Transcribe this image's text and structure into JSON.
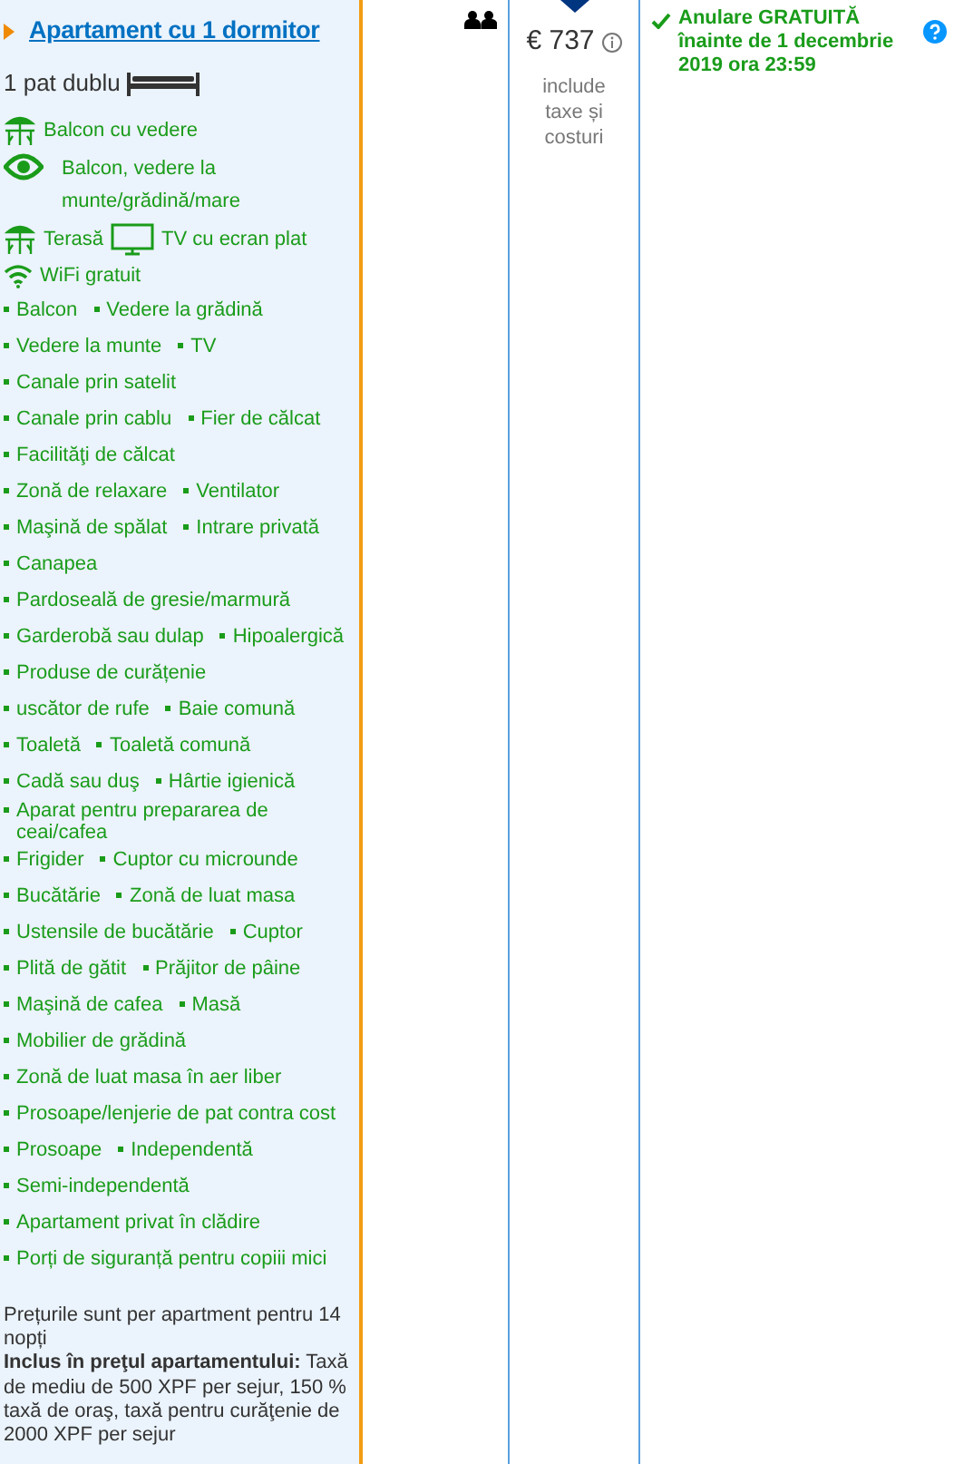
{
  "room": {
    "title": "Apartament cu 1 dormitor",
    "bed": "1 pat dublu",
    "highlights": [
      [
        "Balcon cu vedere"
      ],
      [
        "Balcon, vedere la munte/grădină/mare"
      ],
      [
        "Terasă",
        "TV cu ecran plat"
      ],
      [
        "WiFi gratuit"
      ]
    ],
    "facilities": [
      [
        "Balcon",
        "Vedere la grădină"
      ],
      [
        "Vedere la munte",
        "TV"
      ],
      [
        "Canale prin satelit"
      ],
      [
        "Canale prin cablu",
        "Fier de călcat"
      ],
      [
        "Facilităţi de călcat"
      ],
      [
        "Zonă de relaxare",
        "Ventilator"
      ],
      [
        "Maşină de spălat",
        "Intrare privată"
      ],
      [
        "Canapea"
      ],
      [
        "Pardoseală de gresie/marmură"
      ],
      [
        "Garderobă sau dulap",
        "Hipoalergică"
      ],
      [
        "Produse de curățenie"
      ],
      [
        "uscător de rufe",
        "Baie comună"
      ],
      [
        "Toaletă",
        "Toaletă comună"
      ],
      [
        "Cadă sau duş",
        "Hârtie igienică"
      ],
      [
        "Aparat pentru prepararea de ceai/cafea"
      ],
      [
        "Frigider",
        "Cuptor cu microunde"
      ],
      [
        "Bucătărie",
        "Zonă de luat masa"
      ],
      [
        "Ustensile de bucătărie",
        "Cuptor"
      ],
      [
        "Plită de gătit",
        "Prăjitor de pâine"
      ],
      [
        "Maşină de cafea",
        "Masă"
      ],
      [
        "Mobilier de grădină"
      ],
      [
        "Zonă de luat masa în aer liber"
      ],
      [
        "Prosoape/lenjerie de pat contra cost"
      ],
      [
        "Prosoape",
        "Independentă"
      ],
      [
        "Semi-independentă"
      ],
      [
        "Apartament privat în clădire"
      ],
      [
        "Porți de siguranță pentru copiii mici"
      ]
    ],
    "note": "Prețurile sunt per apartment pentru 14 nopți",
    "included": "**Inclus în preţul apartamentului:** Taxă de mediu de 500 XPF per sejur, 150 % taxă de oraş, taxă pentru curăţenie de 2000 XPF per sejur"
  },
  "price": {
    "amount": "€ 737",
    "taxes": "include taxe și costuri"
  },
  "cancellation": {
    "text": "Anulare GRATUITĂ înainte de 1 decembrie 2019 ora 23:59"
  }
}
